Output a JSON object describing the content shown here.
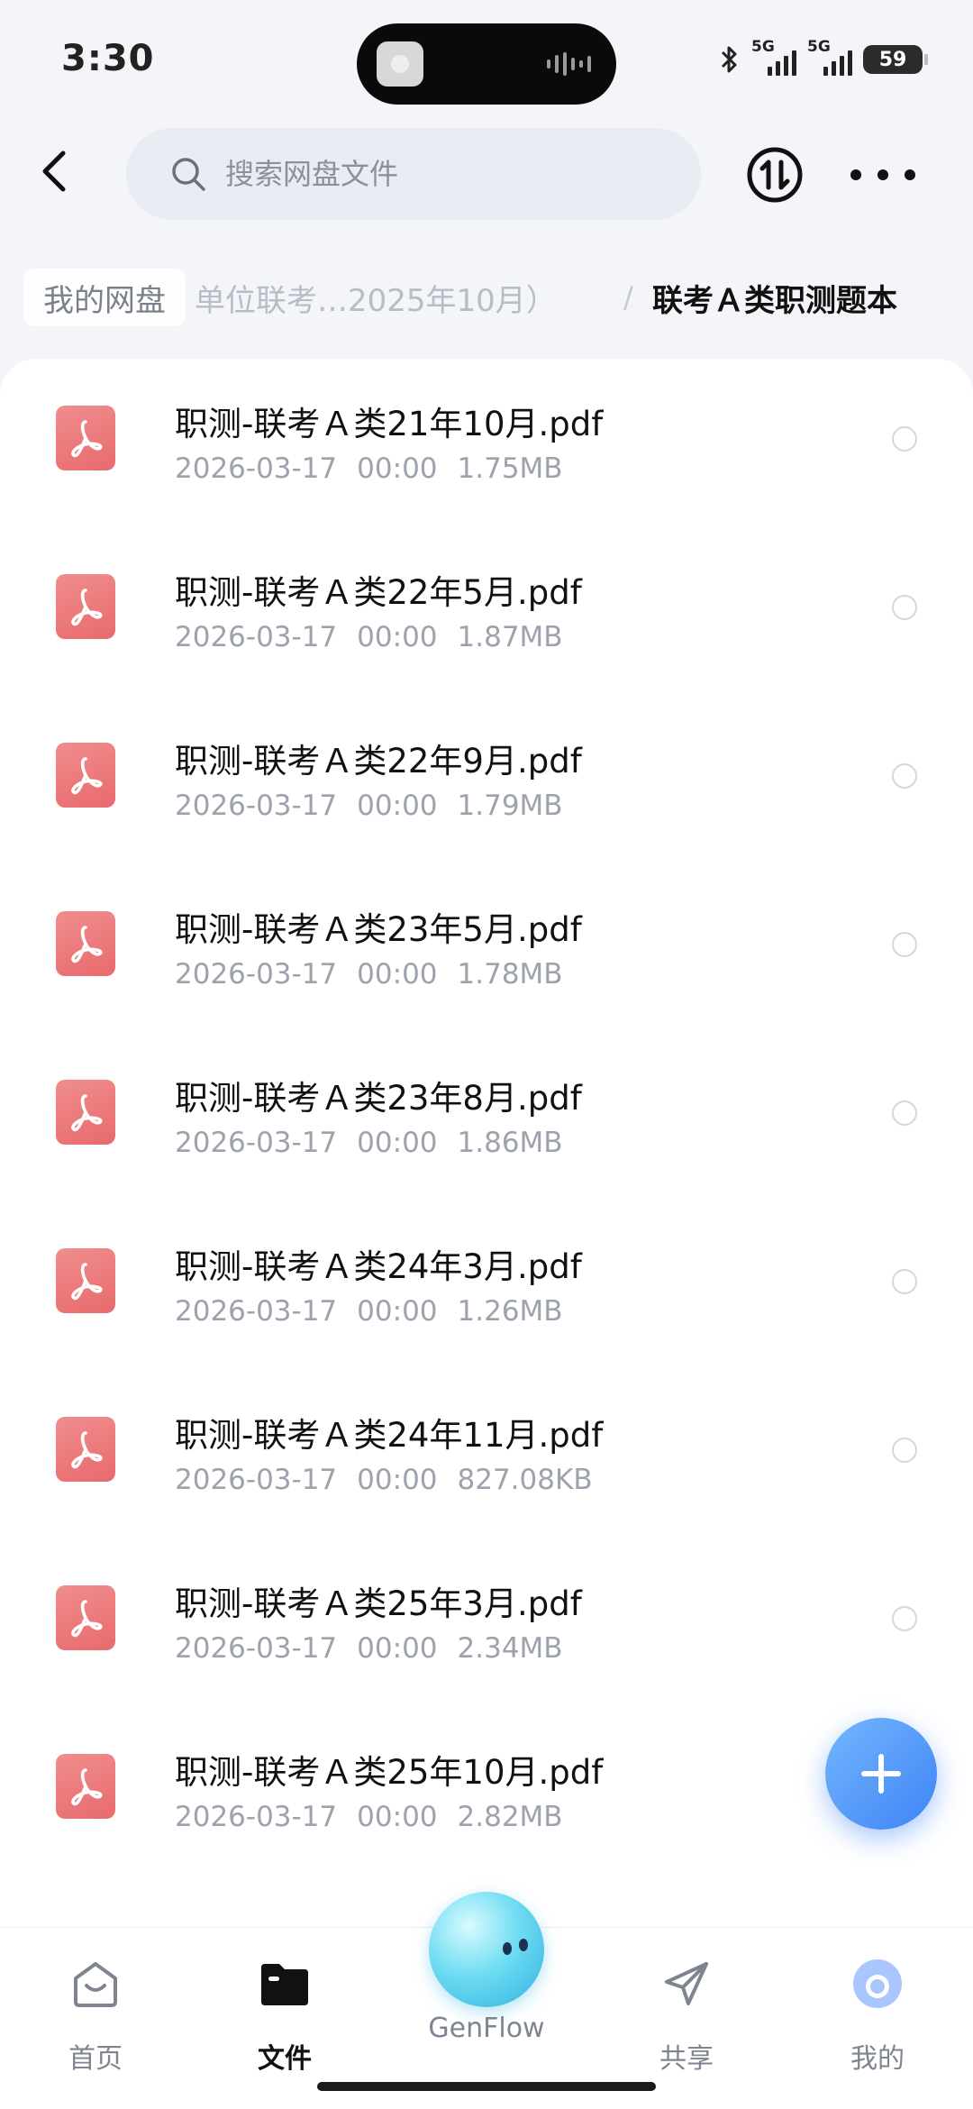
{
  "status_bar": {
    "time": "3:30",
    "sim1": "5G",
    "sim2": "5G",
    "battery": "59"
  },
  "search": {
    "placeholder": "搜索网盘文件"
  },
  "breadcrumb": {
    "home": "我的网盘",
    "middle": "单位联考…2025年10月）",
    "separator": "/",
    "current": "联考Ａ类职测题本"
  },
  "files": [
    {
      "name": "职测-联考Ａ类21年10月.pdf",
      "date": "2026-03-17",
      "time": "00:00",
      "size": "1.75MB"
    },
    {
      "name": "职测-联考Ａ类22年5月.pdf",
      "date": "2026-03-17",
      "time": "00:00",
      "size": "1.87MB"
    },
    {
      "name": "职测-联考Ａ类22年9月.pdf",
      "date": "2026-03-17",
      "time": "00:00",
      "size": "1.79MB"
    },
    {
      "name": "职测-联考Ａ类23年5月.pdf",
      "date": "2026-03-17",
      "time": "00:00",
      "size": "1.78MB"
    },
    {
      "name": "职测-联考Ａ类23年8月.pdf",
      "date": "2026-03-17",
      "time": "00:00",
      "size": "1.86MB"
    },
    {
      "name": "职测-联考Ａ类24年3月.pdf",
      "date": "2026-03-17",
      "time": "00:00",
      "size": "1.26MB"
    },
    {
      "name": "职测-联考Ａ类24年11月.pdf",
      "date": "2026-03-17",
      "time": "00:00",
      "size": "827.08KB"
    },
    {
      "name": "职测-联考Ａ类25年3月.pdf",
      "date": "2026-03-17",
      "time": "00:00",
      "size": "2.34MB"
    },
    {
      "name": "职测-联考Ａ类25年10月.pdf",
      "date": "2026-03-17",
      "time": "00:00",
      "size": "2.82MB"
    }
  ],
  "tabs": {
    "home": "首页",
    "files": "文件",
    "genflow": "GenFlow",
    "share": "共享",
    "mine": "我的"
  },
  "colors": {
    "accent": "#3f83f5",
    "pdf": "#e86a6e"
  }
}
